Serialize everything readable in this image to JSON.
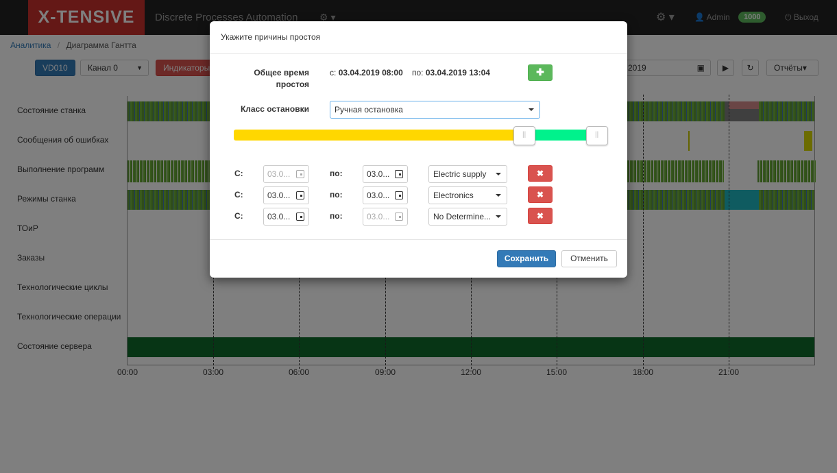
{
  "navbar": {
    "brand": "X-TENSIVE",
    "app_title": "Discrete Processes Automation",
    "admin_label": "Admin",
    "badge": "1000",
    "logout_label": "Выход"
  },
  "breadcrumb": {
    "items": [
      "Аналитика",
      "Диаграмма Гантта"
    ]
  },
  "toolbar": {
    "machine": "VD010",
    "channel": "Канал 0",
    "indicators": "Индикаторы",
    "date_end_visible": "2019",
    "reports": "Отчёты"
  },
  "gantt": {
    "rows": [
      "Состояние станка",
      "Сообщения об ошибках",
      "Выполнение программ",
      "Режимы станка",
      "ТОиР",
      "Заказы",
      "Технологические циклы",
      "Технологические операции",
      "Состояние сервера"
    ],
    "ticks": [
      "00:00",
      "03:00",
      "06:00",
      "09:00",
      "12:00",
      "15:00",
      "18:00",
      "21:00"
    ]
  },
  "modal": {
    "title": "Укажите причины простоя",
    "total_time_label": "Общее время простоя",
    "from_prefix": "с:",
    "from_value": "03.04.2019 08:00",
    "to_prefix": "по:",
    "to_value": "03.04.2019 13:04",
    "stop_class_label": "Класс остановки",
    "stop_class_value": "Ручная остановка",
    "slider": {
      "split_fraction": 0.8,
      "end_fraction": 0.98
    },
    "intervals": [
      {
        "from_label": "С:",
        "from_value": "03.0...",
        "from_disabled": true,
        "to_label": "по:",
        "to_value": "03.0...",
        "to_disabled": false,
        "reason": "Electric supply"
      },
      {
        "from_label": "С:",
        "from_value": "03.0...",
        "from_disabled": false,
        "to_label": "по:",
        "to_value": "03.0...",
        "to_disabled": false,
        "reason": "Electronics"
      },
      {
        "from_label": "С:",
        "from_value": "03.0...",
        "from_disabled": false,
        "to_label": "по:",
        "to_value": "03.0...",
        "to_disabled": true,
        "reason": "No Determine..."
      }
    ],
    "save_label": "Сохранить",
    "cancel_label": "Отменить"
  },
  "colors": {
    "brand": "#c9302c",
    "primary": "#337ab7",
    "success": "#5cb85c",
    "danger": "#d9534f",
    "slider_yellow": "#ffd700",
    "slider_green": "#00f28c",
    "server_state": "#0e6b2b"
  }
}
